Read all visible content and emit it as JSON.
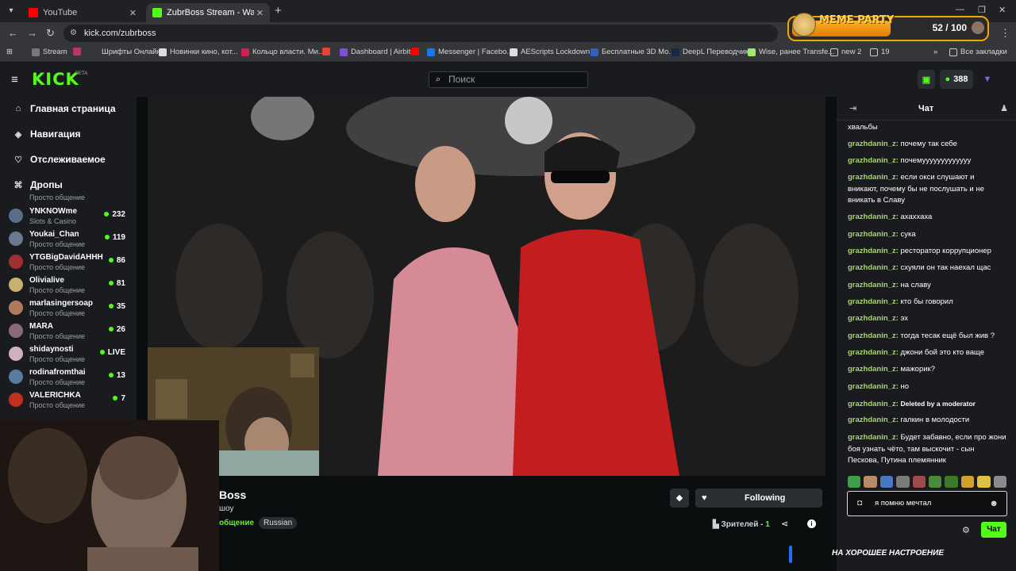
{
  "browser": {
    "tabs": [
      {
        "title": "YouTube",
        "active": false
      },
      {
        "title": "ZubrBoss Stream - Watch L",
        "active": true
      }
    ],
    "new_tab": "+",
    "url": "kick.com/zubrboss",
    "bookmarks": [
      "Stream",
      "Шрифты Онлайн",
      "Новинки кино, кот...",
      "Кольцо власти. Ми...",
      "Dashboard | Airbit",
      "Messenger | Facebo...",
      "AEScripts Lockdown...",
      "Бесплатные 3D Мо...",
      "DeepL Переводчик",
      "Wise, ранее Transfe...",
      "new 2",
      "19"
    ],
    "all_bookmarks": "Все закладки"
  },
  "overlay": {
    "title": "MEME PARTY",
    "count": "52 / 100"
  },
  "header": {
    "logo": "KICK",
    "beta": "BETA",
    "search_placeholder": "Поиск",
    "points": "388"
  },
  "sidebar": {
    "nav": [
      {
        "label": "Главная страница",
        "icon": "home-icon"
      },
      {
        "label": "Навигация",
        "icon": "compass-icon"
      },
      {
        "label": "Отслеживаемое",
        "icon": "heart-icon"
      },
      {
        "label": "Дропы",
        "icon": "gift-icon"
      }
    ],
    "cut_label": "Просто общение",
    "channels": [
      {
        "name": "YNKNOWme",
        "category": "Slots & Casino",
        "viewers": "232",
        "color": "#5a6e8a"
      },
      {
        "name": "Youkai_Chan",
        "category": "Просто общение",
        "viewers": "119",
        "color": "#6a7a8e"
      },
      {
        "name": "YTGBigDavidAHHH",
        "category": "Просто общение",
        "viewers": "86",
        "color": "#a03030"
      },
      {
        "name": "Olivialive",
        "category": "Просто общение",
        "viewers": "81",
        "color": "#c8b070"
      },
      {
        "name": "marlasingersoap",
        "category": "Просто общение",
        "viewers": "35",
        "color": "#b07a5a"
      },
      {
        "name": "MARA",
        "category": "Просто общение",
        "viewers": "26",
        "color": "#8a6a7a"
      },
      {
        "name": "shidaynosti",
        "category": "Просто общение",
        "viewers": "LIVE",
        "color": "#d0b0c0"
      },
      {
        "name": "rodinafromthai",
        "category": "Просто общение",
        "viewers": "13",
        "color": "#5a7aa0"
      },
      {
        "name": "VALERICHKA",
        "category": "Просто общение",
        "viewers": "7",
        "color": "#c03020"
      }
    ]
  },
  "stream": {
    "title": "Boss",
    "subtitle": "шоу",
    "category": "общение",
    "language": "Russian",
    "follow_label": "Following",
    "viewers_label": "Зрителей -",
    "viewers_count": "1"
  },
  "chat": {
    "title": "Чат",
    "first_line": "хвальбы",
    "messages": [
      {
        "user": "grazhdanin_z:",
        "text": "почему так себе"
      },
      {
        "user": "grazhdanin_z:",
        "text": "почемууууууууууууу"
      },
      {
        "user": "grazhdanin_z:",
        "text": "если окси слушают и вникают, почему бы не послушать и не вникать в Славу"
      },
      {
        "user": "grazhdanin_z:",
        "text": "ахаххаха"
      },
      {
        "user": "grazhdanin_z:",
        "text": "сука"
      },
      {
        "user": "grazhdanin_z:",
        "text": "ресторатор коррупционер"
      },
      {
        "user": "grazhdanin_z:",
        "text": "схуяли он так наехал щас"
      },
      {
        "user": "grazhdanin_z:",
        "text": "на славу"
      },
      {
        "user": "grazhdanin_z:",
        "text": "кто бы говорил"
      },
      {
        "user": "grazhdanin_z:",
        "text": "эх"
      },
      {
        "user": "grazhdanin_z:",
        "text": "тогда тесак ещё был жив ?"
      },
      {
        "user": "grazhdanin_z:",
        "text": "джони бой это кто ваще"
      },
      {
        "user": "grazhdanin_z:",
        "text": "мажорик?"
      },
      {
        "user": "grazhdanin_z:",
        "text": "но"
      },
      {
        "user": "grazhdanin_z:",
        "text": "Deleted by a moderator"
      },
      {
        "user": "grazhdanin_z:",
        "text": "галкин в молодости"
      },
      {
        "user": "grazhdanin_z:",
        "text": "Будет забавно, если про жони боя узнать чёто, там выскочит - сын Пескова, Путина племянник"
      }
    ],
    "input_value": "я помню мечтал",
    "send_label": "Чат"
  },
  "banner_text": "НА ХОРОШЕЕ НАСТРОЕНИЕ",
  "colors": {
    "accent": "#53fc18",
    "username": "#a8d66a",
    "background": "#191b1f"
  }
}
